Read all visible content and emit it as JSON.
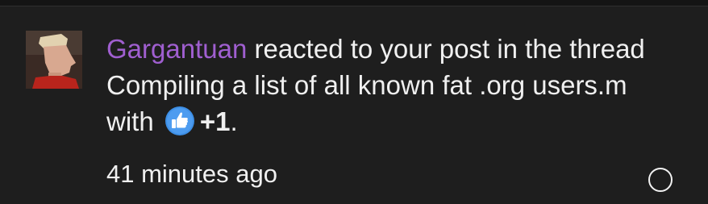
{
  "alert": {
    "username": "Gargantuan",
    "text_before_thread": " reacted to your post in the thread ",
    "thread_title": "Compiling a list of all known fat .org users.m",
    "text_with": " with ",
    "reaction_label": "+1",
    "text_end": ".",
    "timestamp": "41 minutes ago",
    "reaction_icon": "thumbs-up-icon",
    "username_color": "#a05fd0",
    "reaction_color": "#3d8fe6"
  }
}
